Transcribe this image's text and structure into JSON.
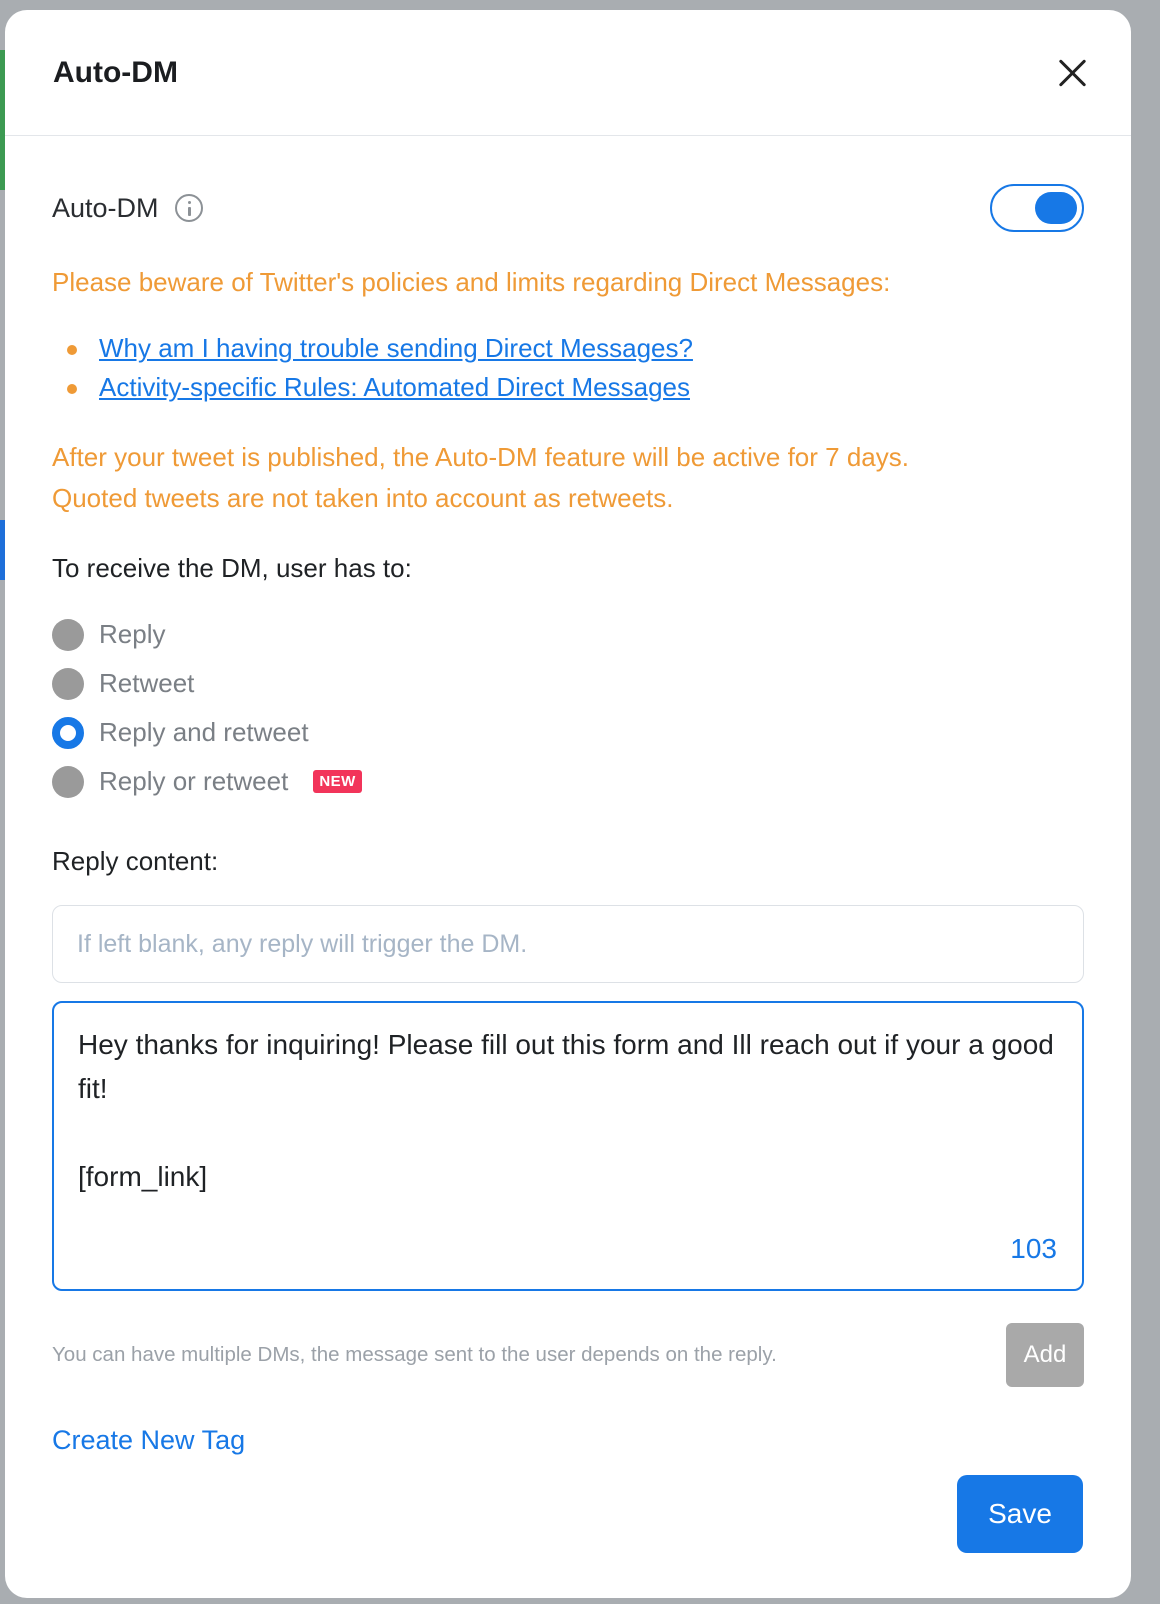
{
  "modal": {
    "title": "Auto-DM",
    "close_icon": "close-icon"
  },
  "toggle": {
    "label": "Auto-DM",
    "info_icon": "info-icon",
    "enabled": true
  },
  "warning": {
    "intro": "Please beware of Twitter's policies and limits regarding Direct Messages:",
    "links": [
      "Why am I having trouble sending Direct Messages?",
      "Activity-specific Rules: Automated Direct Messages"
    ],
    "note_line1": "After your tweet is published, the Auto-DM feature will be active for 7 days.",
    "note_line2": "Quoted tweets are not taken into account as retweets."
  },
  "receive": {
    "label": "To receive the DM, user has to:",
    "options": [
      {
        "label": "Reply",
        "selected": false
      },
      {
        "label": "Retweet",
        "selected": false
      },
      {
        "label": "Reply and retweet",
        "selected": true
      },
      {
        "label": "Reply or retweet",
        "selected": false,
        "badge": "NEW"
      }
    ]
  },
  "reply_content": {
    "label": "Reply content:",
    "placeholder": "If left blank, any reply will trigger the DM.",
    "value": ""
  },
  "dm_message": {
    "text": "Hey thanks for inquiring! Please fill out this form and Ill reach out if your a good fit!\n\n[form_link]",
    "char_count": "103"
  },
  "footer": {
    "hint": "You can have multiple DMs, the message sent to the user depends on the reply.",
    "add_label": "Add",
    "create_tag_label": "Create New Tag",
    "save_label": "Save"
  },
  "colors": {
    "accent": "#1778e6",
    "warning": "#ef9a36",
    "badge": "#f2345a"
  }
}
